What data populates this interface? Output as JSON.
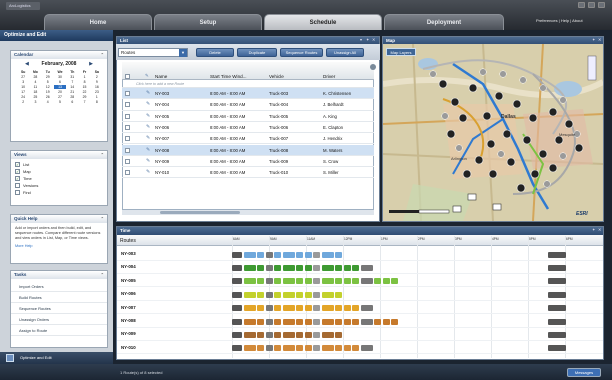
{
  "app": {
    "logo": "ArcLogistics"
  },
  "window_buttons": [
    "minimize",
    "maximize",
    "close"
  ],
  "tabs": [
    {
      "label": "Home",
      "active": false
    },
    {
      "label": "Setup",
      "active": false
    },
    {
      "label": "Schedule",
      "active": true
    },
    {
      "label": "Deployment",
      "active": false
    }
  ],
  "top_links": "Preferences | Help | About",
  "left": {
    "title": "Optimize and Edit",
    "calendar": {
      "title": "Calendar",
      "month": "February, 2008",
      "days": [
        "Su",
        "Mo",
        "Tu",
        "We",
        "Th",
        "Fr",
        "Sa"
      ],
      "dates": [
        "27",
        "28",
        "29",
        "30",
        "31",
        "1",
        "2",
        "3",
        "4",
        "5",
        "6",
        "7",
        "8",
        "9",
        "10",
        "11",
        "12",
        "13",
        "14",
        "15",
        "16",
        "17",
        "18",
        "19",
        "20",
        "21",
        "22",
        "23",
        "24",
        "25",
        "26",
        "27",
        "28",
        "29",
        "1",
        "2",
        "3",
        "4",
        "5",
        "6",
        "7",
        "8"
      ],
      "selected_index": 17
    },
    "views": {
      "title": "Views",
      "items": [
        {
          "label": "List",
          "checked": true
        },
        {
          "label": "Map",
          "checked": true
        },
        {
          "label": "Time",
          "checked": true
        },
        {
          "label": "Versions",
          "checked": false
        },
        {
          "label": "Find",
          "checked": false
        }
      ]
    },
    "quick_help": {
      "title": "Quick Help",
      "text": "Add or import orders and then build, edit, and sequence routes. Compare different route versions and view orders in List, Map, or Time views.",
      "more": "More Help"
    },
    "tasks": {
      "title": "Tasks",
      "items": [
        "Import Orders",
        "Build Routes",
        "Sequence Routes",
        "Unassign Orders",
        "Assign to Route"
      ]
    },
    "footer": "Optimize and Edit"
  },
  "list": {
    "title": "List",
    "select_value": "Routes",
    "buttons": [
      "Delete",
      "Duplicate",
      "Sequence Routes",
      "Unassign All"
    ],
    "columns": [
      "Name",
      "Start Time Wind...",
      "Vehicle",
      "Driver"
    ],
    "add_row_hint": "Click here to add a new Route",
    "rows": [
      {
        "name": "NY-003",
        "time": "8:00 AM - 8:00 AM",
        "vehicle": "Truck-003",
        "driver": "K. Christensen",
        "selected": true
      },
      {
        "name": "NY-004",
        "time": "8:00 AM - 8:00 AM",
        "vehicle": "Truck-004",
        "driver": "J. Belhardt",
        "selected": false
      },
      {
        "name": "NY-005",
        "time": "8:00 AM - 8:00 AM",
        "vehicle": "Truck-005",
        "driver": "A. King",
        "selected": false
      },
      {
        "name": "NY-006",
        "time": "8:00 AM - 8:00 AM",
        "vehicle": "Truck-006",
        "driver": "E. Clapton",
        "selected": false
      },
      {
        "name": "NY-007",
        "time": "8:00 AM - 8:00 AM",
        "vehicle": "Truck-007",
        "driver": "J. Hendrix",
        "selected": false
      },
      {
        "name": "NY-008",
        "time": "8:00 AM - 8:00 AM",
        "vehicle": "Truck-008",
        "driver": "M. Waters",
        "selected": true
      },
      {
        "name": "NY-009",
        "time": "8:00 AM - 8:00 AM",
        "vehicle": "Truck-009",
        "driver": "S. Crow",
        "selected": false
      },
      {
        "name": "NY-010",
        "time": "8:00 AM - 8:00 AM",
        "vehicle": "Truck-010",
        "driver": "S. Miller",
        "selected": false
      }
    ]
  },
  "map": {
    "title": "Map",
    "layers_button": "Map Layers",
    "labels": [
      "Dallas",
      "Arlington",
      "Mesquite"
    ],
    "brand": "ESRI"
  },
  "time": {
    "title": "Time",
    "routes_label": "Routes",
    "ticks": [
      "6AM",
      "9AM",
      "11AM",
      "12PM",
      "1PM",
      "2PM",
      "3PM",
      "4PM",
      "5PM",
      "6PM"
    ],
    "rows": [
      {
        "label": "NY-003",
        "color": "#6fa8dc"
      },
      {
        "label": "NY-004",
        "color": "#3e9a32"
      },
      {
        "label": "NY-005",
        "color": "#7cc242"
      },
      {
        "label": "NY-006",
        "color": "#c3d12c"
      },
      {
        "label": "NY-007",
        "color": "#e3a528"
      },
      {
        "label": "NY-008",
        "color": "#c67a2c"
      },
      {
        "label": "NY-009",
        "color": "#a56a32"
      },
      {
        "label": "NY-010",
        "color": "#d28a3a"
      }
    ]
  },
  "status": {
    "text": "1 Route(s) of 8 selected",
    "messages": "Messages"
  },
  "colors": {
    "accent": "#2f4c72",
    "selection": "#cfe0f3",
    "brand": "#3d6fb4"
  }
}
